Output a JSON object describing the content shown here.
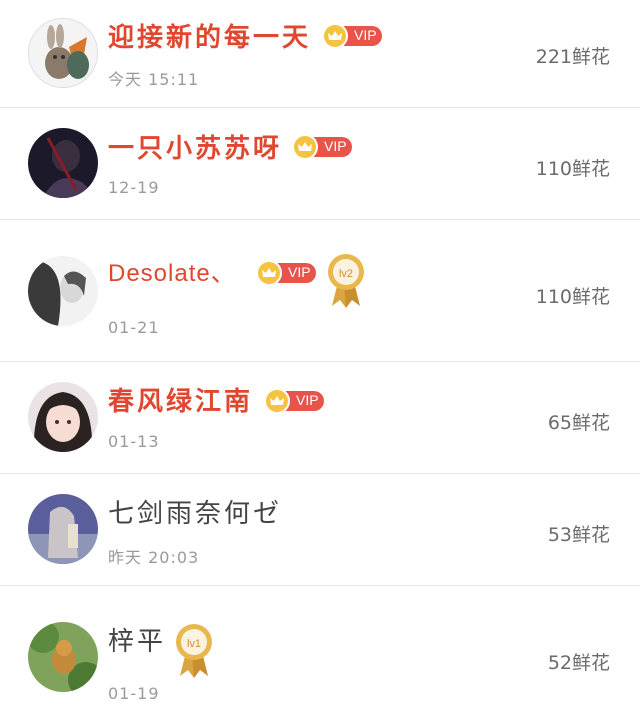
{
  "colors": {
    "vip_name": "#e0472f",
    "vip_badge": "#e8534a",
    "crown": "#f6c340",
    "medal": "#d9a441",
    "divider": "#e8e8e8",
    "muted_text": "#9a9a9a"
  },
  "vip_badge_label": "VIP",
  "flower_unit": "鲜花",
  "rows": [
    {
      "name": "迎接新的每一天",
      "time": "今天 15:11",
      "flowers": "221鲜花",
      "vip": true,
      "medal": null,
      "avatar_icon": "fox-bunny-cartoon"
    },
    {
      "name": "一只小苏苏呀",
      "time": "12-19",
      "flowers": "110鲜花",
      "vip": true,
      "medal": null,
      "avatar_icon": "dark-portrait"
    },
    {
      "name": "Desolate、",
      "time": "01-21",
      "flowers": "110鲜花",
      "vip": true,
      "medal": "lv2-medal-icon",
      "medal_text": "lv2",
      "avatar_icon": "sketch-portrait"
    },
    {
      "name": "春风绿江南",
      "time": "01-13",
      "flowers": "65鲜花",
      "vip": true,
      "medal": null,
      "avatar_icon": "girl-portrait"
    },
    {
      "name": "七剑雨奈何ゼ",
      "time": "昨天 20:03",
      "flowers": "53鲜花",
      "vip": false,
      "medal": null,
      "avatar_icon": "blue-abstract"
    },
    {
      "name": "梓平",
      "time": "01-19",
      "flowers": "52鲜花",
      "vip": false,
      "medal": "lv1-medal-icon",
      "medal_text": "lv1",
      "avatar_icon": "cat-tree"
    }
  ]
}
